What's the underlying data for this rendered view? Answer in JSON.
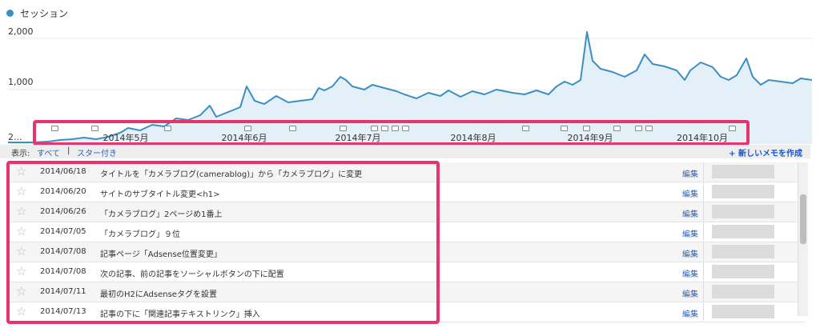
{
  "legend": {
    "label": "セッション",
    "color": "#3b8fc4"
  },
  "chart_data": {
    "type": "area",
    "series": [
      {
        "name": "セッション",
        "values": []
      }
    ],
    "yticks": [
      "2,000",
      "1,000",
      "2..."
    ],
    "ylim": [
      0,
      2000
    ],
    "grid": true,
    "x_labels": [
      "2014年5月",
      "2014年6月",
      "2014年7月",
      "2014年8月",
      "2014年9月",
      "2014年10月"
    ],
    "line_color": "#3b8fc4",
    "fill_color": "#e3f0f8"
  },
  "filter_bar": {
    "display_label": "表示:",
    "all_label": "すべて",
    "separator": "|",
    "starred_label": "スター付き",
    "new_memo_label": "+ 新しいメモを作成"
  },
  "memos": [
    {
      "date": "2014/06/18",
      "text": "タイトルを「カメラブログ(camerablog)」から「カメラブログ」に変更",
      "edit": "編集"
    },
    {
      "date": "2014/06/20",
      "text": "サイトのサブタイトル変更<h1>",
      "edit": "編集"
    },
    {
      "date": "2014/06/26",
      "text": "「カメラブログ」2ページめ1番上",
      "edit": "編集"
    },
    {
      "date": "2014/07/05",
      "text": "「カメラブログ」９位",
      "edit": "編集"
    },
    {
      "date": "2014/07/08",
      "text": "記事ページ「Adsense位置変更」",
      "edit": "編集"
    },
    {
      "date": "2014/07/08",
      "text": "次の記事、前の記事をソーシャルボタンの下に配置",
      "edit": "編集"
    },
    {
      "date": "2014/07/11",
      "text": "最初のH2にAdsenseタグを設置",
      "edit": "編集"
    },
    {
      "date": "2014/07/13",
      "text": "記事の下に「関連記事テキストリンク」挿入",
      "edit": "編集"
    }
  ],
  "icons": {
    "star": "star-outline-icon",
    "marker": "memo-marker-icon"
  },
  "colors": {
    "highlight": "#e8336d",
    "link": "#3460a5"
  }
}
